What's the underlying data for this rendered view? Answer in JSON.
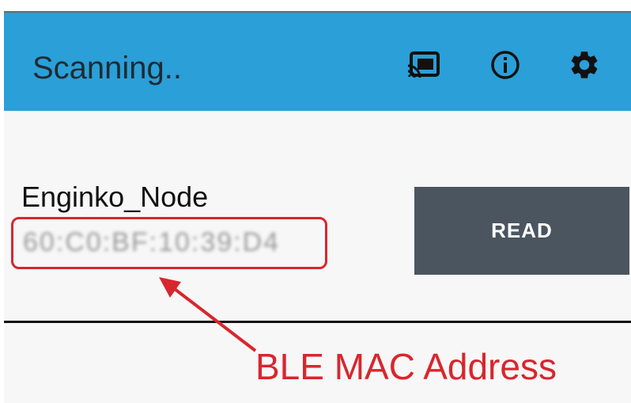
{
  "appbar": {
    "title": "Scanning..",
    "background": "#2a9fd8",
    "actions": [
      {
        "icon": "cast-icon"
      },
      {
        "icon": "info-icon"
      },
      {
        "icon": "settings-gear-icon"
      }
    ]
  },
  "device": {
    "name": "Enginko_Node",
    "mac_address": "60:C0:BF:10:39:D4",
    "read_label": "READ",
    "read_button_color": "#4b5560"
  },
  "annotation": {
    "label": "BLE MAC Address",
    "color": "#d8262e"
  }
}
